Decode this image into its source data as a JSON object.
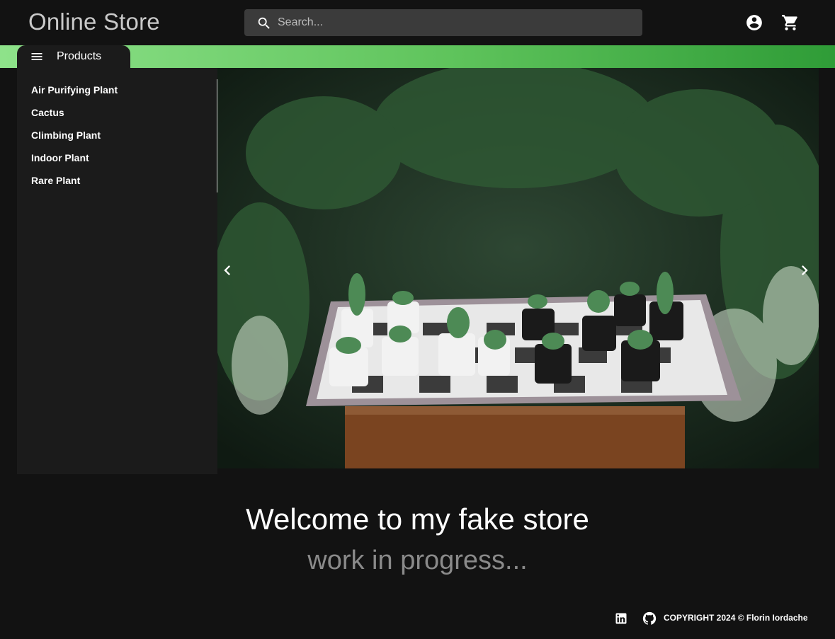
{
  "header": {
    "brand": "Online Store",
    "search_placeholder": "Search...",
    "account_icon": "account-circle-icon",
    "cart_icon": "shopping-cart-icon"
  },
  "nav": {
    "products_label": "Products",
    "menu_icon": "menu-icon",
    "categories": [
      "Air Purifying Plant",
      "Cactus",
      "Climbing Plant",
      "Indoor Plant",
      "Rare Plant"
    ]
  },
  "carousel": {
    "image_description_icon": "cactus-chessboard-photo",
    "prev_icon": "chevron-left-icon",
    "next_icon": "chevron-right-icon"
  },
  "main": {
    "welcome": "Welcome to my fake store",
    "subtitle": "work in progress..."
  },
  "footer": {
    "copyright": "COPYRIGHT 2024 © Florin Iordache",
    "linkedin_icon": "linkedin-icon",
    "github_icon": "github-icon"
  },
  "colors": {
    "background": "#121212",
    "accent_green": "#5ec35b",
    "drawer": "#1b1b1b"
  }
}
